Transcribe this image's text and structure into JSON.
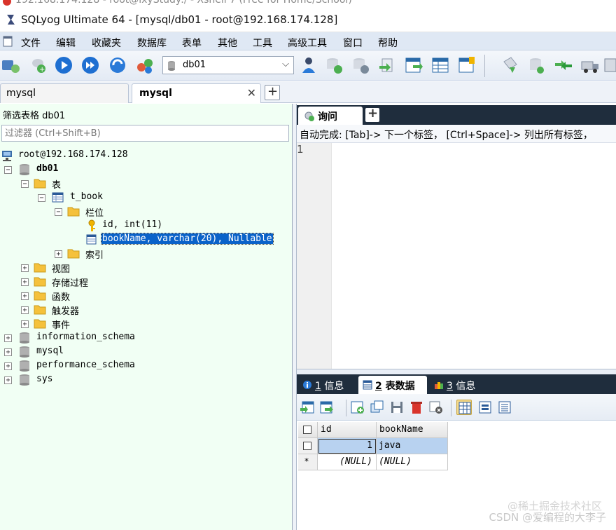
{
  "xshell_title": "192.168.174.128 - root@ixyStudy:/ - Xshell 7 (Free for Home/School)",
  "window_title": "SQLyog Ultimate 64 - [mysql/db01 - root@192.168.174.128]",
  "menu": [
    "文件",
    "编辑",
    "收藏夹",
    "数据库",
    "表单",
    "其他",
    "工具",
    "高级工具",
    "窗口",
    "帮助"
  ],
  "toolbar": {
    "db_selected": "db01"
  },
  "connection_tabs": [
    {
      "label": "mysql"
    },
    {
      "label": "mysql"
    }
  ],
  "object_browser": {
    "filter_label": "筛选表格 db01",
    "filter_placeholder": "过滤器 (Ctrl+Shift+B)",
    "server": "root@192.168.174.128",
    "database": "db01",
    "tables_folder": "表",
    "table": "t_book",
    "columns_folder": "栏位",
    "col_id": "id, int(11)",
    "col_bookname": "bookName, varchar(20), Nullable",
    "index_folder": "索引",
    "views": "视图",
    "procedures": "存储过程",
    "functions": "函数",
    "triggers": "触发器",
    "events": "事件",
    "other_dbs": [
      "information_schema",
      "mysql",
      "performance_schema",
      "sys"
    ]
  },
  "query": {
    "tab_label": "询问",
    "autocomplete_hint": "自动完成: [Tab]-> 下一个标签， [Ctrl+Space]-> 列出所有标签，",
    "line_number": "1"
  },
  "results": {
    "tabs": [
      {
        "num": "1",
        "label": "信息"
      },
      {
        "num": "2",
        "label": "表数据"
      },
      {
        "num": "3",
        "label": "信息"
      }
    ],
    "columns": [
      "id",
      "bookName"
    ],
    "rows": [
      {
        "id": "1",
        "bookName": "java"
      }
    ],
    "new_row": {
      "marker": "*",
      "id": "(NULL)",
      "bookName": "(NULL)"
    }
  },
  "watermark": "CSDN @爱编程的大李子",
  "watermark_faint": "@稀土掘金技术社区",
  "colors": {
    "selection": "#0a62c9",
    "tree_bg": "#f1fff4",
    "menu_bg": "#dfe8f4",
    "tab_strip": "#1f2d3d",
    "selected_cell": "#b8d2f0"
  }
}
